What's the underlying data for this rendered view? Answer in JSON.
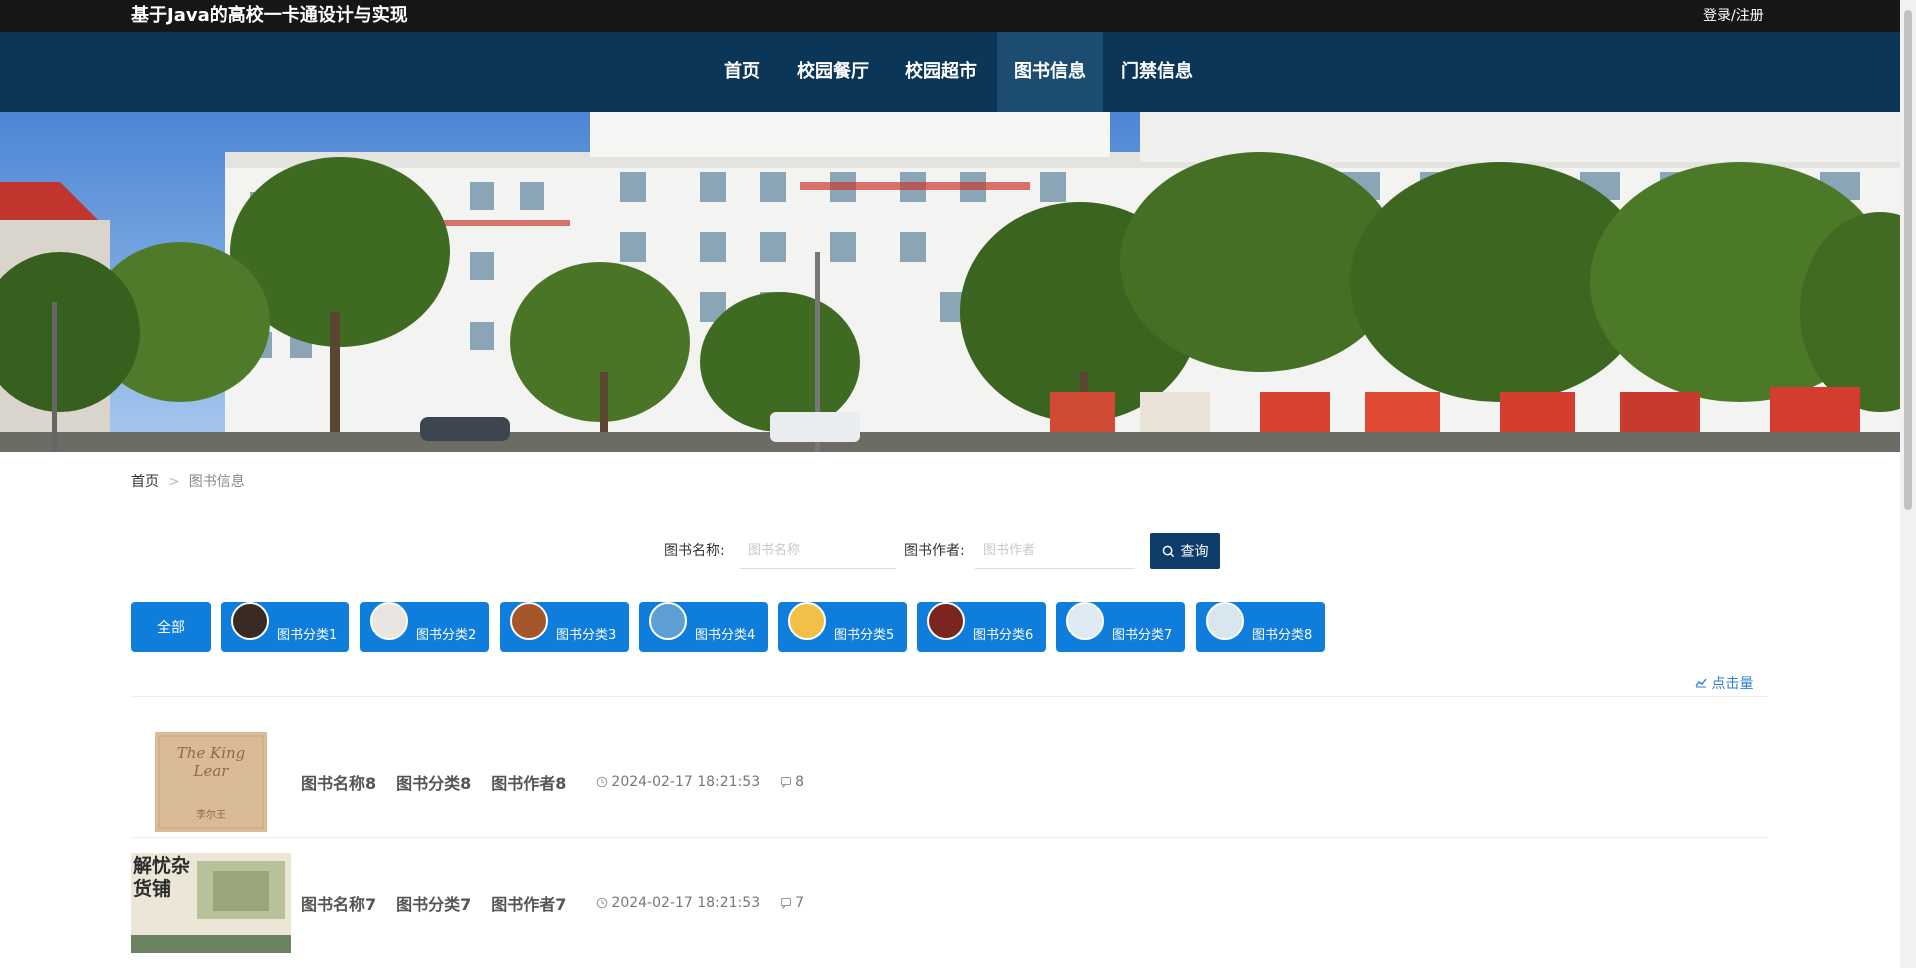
{
  "header": {
    "site_title": "基于Java的高校一卡通设计与实现",
    "login_label": "登录/注册"
  },
  "nav": {
    "items": [
      {
        "label": "首页"
      },
      {
        "label": "校园餐厅"
      },
      {
        "label": "校园超市"
      },
      {
        "label": "图书信息",
        "active": true
      },
      {
        "label": "门禁信息"
      }
    ]
  },
  "breadcrumb": {
    "home": "首页",
    "separator": ">",
    "current": "图书信息"
  },
  "search": {
    "name_label": "图书名称:",
    "name_placeholder": "图书名称",
    "author_label": "图书作者:",
    "author_placeholder": "图书作者",
    "button_label": "查询"
  },
  "categories": {
    "all_label": "全部",
    "items": [
      {
        "label": "图书分类1",
        "thumb_color": "#3a2a24"
      },
      {
        "label": "图书分类2",
        "thumb_color": "#e9e6e1"
      },
      {
        "label": "图书分类3",
        "thumb_color": "#a5562b"
      },
      {
        "label": "图书分类4",
        "thumb_color": "#5f9fd6"
      },
      {
        "label": "图书分类5",
        "thumb_color": "#f2c046"
      },
      {
        "label": "图书分类6",
        "thumb_color": "#7a2520"
      },
      {
        "label": "图书分类7",
        "thumb_color": "#dfe9f2"
      },
      {
        "label": "图书分类8",
        "thumb_color": "#d8e6f0"
      }
    ]
  },
  "sort": {
    "label": "点击量"
  },
  "books": [
    {
      "name": "图书名称8",
      "category": "图书分类8",
      "author": "图书作者8",
      "date": "2024-02-17 18:21:53",
      "count": "8",
      "cover_title": "The King Lear",
      "cover_text": "李尔王"
    },
    {
      "name": "图书名称7",
      "category": "图书分类7",
      "author": "图书作者7",
      "date": "2024-02-17 18:21:53",
      "count": "7",
      "cover_title": "解忧杂货铺"
    }
  ],
  "colors": {
    "topbar": "#161616",
    "navbar": "#0b3658",
    "nav_active": "#1d4c71",
    "search_button": "#0e3d6b",
    "category_button": "#0f7ddb",
    "link": "#2d7fd2"
  }
}
